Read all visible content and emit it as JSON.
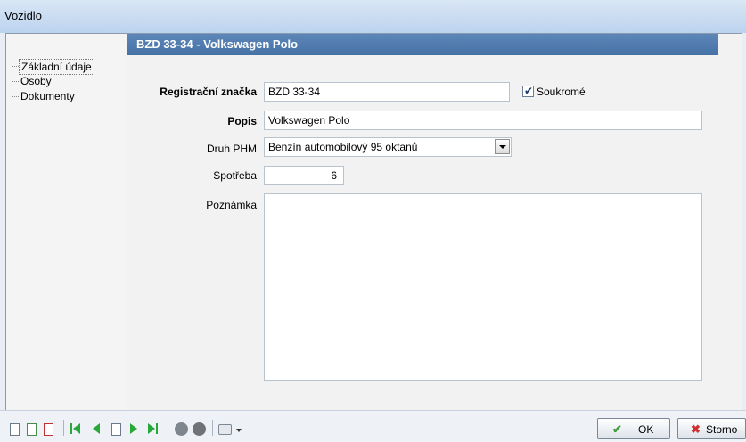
{
  "window": {
    "title": "Vozidlo"
  },
  "tree": {
    "items": [
      {
        "label": "Základní údaje",
        "selected": true
      },
      {
        "label": "Osoby",
        "selected": false
      },
      {
        "label": "Dokumenty",
        "selected": false
      }
    ]
  },
  "header": {
    "title": "BZD 33-34  -  Volkswagen Polo"
  },
  "form": {
    "registration": {
      "label": "Registrační značka",
      "value": "BZD 33-34"
    },
    "private": {
      "label": "Soukromé",
      "checked": true
    },
    "description": {
      "label": "Popis",
      "value": "Volkswagen Polo"
    },
    "fuel": {
      "label": "Druh PHM",
      "value": "Benzín automobilový 95 oktanů"
    },
    "consumption": {
      "label": "Spotřeba",
      "value": "6"
    },
    "note": {
      "label": "Poznámka",
      "value": ""
    }
  },
  "toolbar": {
    "icons": [
      "new-record-icon",
      "edit-record-icon",
      "delete-record-icon",
      "first-record-icon",
      "previous-record-icon",
      "browse-records-icon",
      "next-record-icon",
      "last-record-icon",
      "confirm-icon",
      "cancel-icon",
      "print-icon",
      "dropdown-icon"
    ],
    "ok_label": "OK",
    "cancel_label": "Storno"
  },
  "colors": {
    "header": "#4f7bb0",
    "title_bar": "#c8daf0",
    "ok_check": "#3c9c3c",
    "cancel_x": "#d03030"
  }
}
